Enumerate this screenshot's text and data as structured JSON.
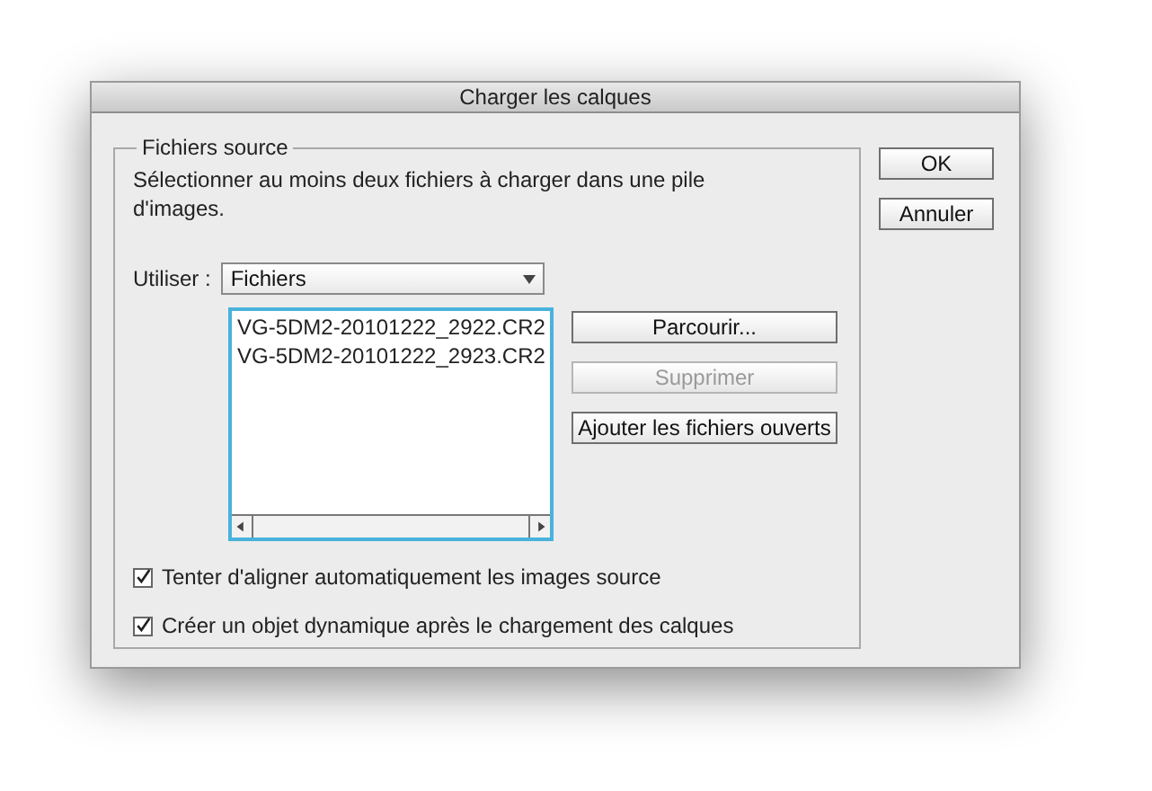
{
  "window": {
    "title": "Charger les calques"
  },
  "source": {
    "legend": "Fichiers source",
    "description": "Sélectionner au moins deux fichiers à charger dans une pile d'images.",
    "use_label": "Utiliser :",
    "use_value": "Fichiers",
    "files": [
      "VG-5DM2-20101222_2922.CR2",
      "VG-5DM2-20101222_2923.CR2"
    ],
    "actions": [
      {
        "label": "Parcourir...",
        "disabled": false
      },
      {
        "label": "Supprimer",
        "disabled": true
      },
      {
        "label": "Ajouter les fichiers ouverts",
        "disabled": false
      }
    ]
  },
  "options": [
    {
      "label": "Tenter d'aligner automatiquement les images source",
      "checked": true
    },
    {
      "label": "Créer un objet dynamique après le chargement des calques",
      "checked": true
    }
  ],
  "buttons": [
    "OK",
    "Annuler"
  ]
}
